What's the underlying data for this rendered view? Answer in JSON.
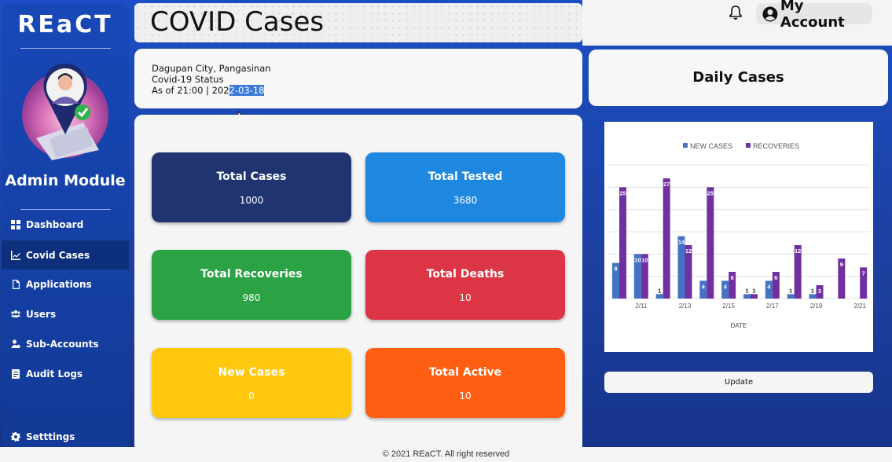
{
  "sidebar": {
    "logo": "REaCT",
    "module_title": "Admin Module",
    "items": [
      {
        "label": "Dashboard",
        "icon": "grid-icon"
      },
      {
        "label": "Covid Cases",
        "icon": "chart-icon"
      },
      {
        "label": "Applications",
        "icon": "document-icon"
      },
      {
        "label": "Users",
        "icon": "users-icon"
      },
      {
        "label": "Sub-Accounts",
        "icon": "user-gear-icon"
      },
      {
        "label": "Audit Logs",
        "icon": "log-icon"
      }
    ],
    "settings_label": "Setttings",
    "active_item": "Covid Cases"
  },
  "header": {
    "title": "COVID Cases",
    "account_label": "My Account"
  },
  "location": {
    "place": "Dagupan City, Pangasinan",
    "status": "Covid-19 Status",
    "as_of_prefix": "As of 21:00 | 202",
    "as_of_selected": "2-03-18"
  },
  "stats": [
    {
      "label": "Total Cases",
      "value": "1000",
      "color": "#1f3471"
    },
    {
      "label": "Total Tested",
      "value": "3680",
      "color": "#1e88e0"
    },
    {
      "label": "Total Recoveries",
      "value": "980",
      "color": "#2ba244"
    },
    {
      "label": "Total Deaths",
      "value": "10",
      "color": "#dc3545"
    },
    {
      "label": "New Cases",
      "value": "0",
      "color": "#fdc80d"
    },
    {
      "label": "Total Active",
      "value": "10",
      "color": "#fd5e12"
    }
  ],
  "daily": {
    "title": "Daily Cases",
    "update_label": "Update"
  },
  "chart_data": {
    "type": "bar",
    "x_tick_labels": [
      "2/11",
      "2/13",
      "2/15",
      "2/17",
      "2/19",
      "2/21"
    ],
    "xlabel": "DATE",
    "legend_position": "top",
    "series": [
      {
        "name": "NEW CASES",
        "color": "#4472c4",
        "values": [
          8,
          10,
          1,
          14,
          4,
          4,
          1,
          4,
          1,
          1,
          null,
          null
        ]
      },
      {
        "name": "RECOVERIES",
        "color": "#7030a0",
        "values": [
          25,
          10,
          27,
          12,
          25,
          6,
          1,
          6,
          12,
          3,
          9,
          7
        ]
      }
    ],
    "ylim": [
      0,
      30
    ],
    "gridlines": true
  },
  "footer": {
    "text": "© 2021 REaCT. All right reserved"
  }
}
